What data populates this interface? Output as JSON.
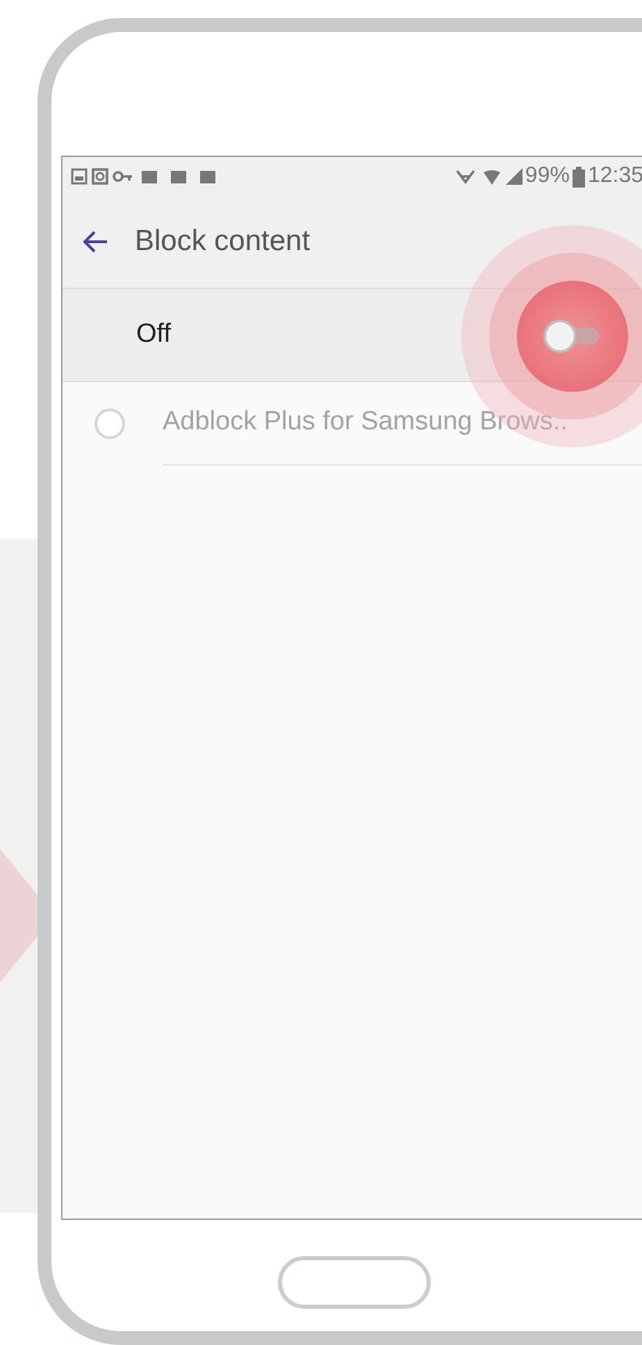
{
  "status_bar": {
    "battery": "99%",
    "time": "12:35"
  },
  "header": {
    "title": "Block content"
  },
  "master_switch": {
    "label": "Off",
    "on": false
  },
  "items": [
    {
      "label": "Adblock Plus for Samsung Brows..",
      "selected": false
    }
  ]
}
